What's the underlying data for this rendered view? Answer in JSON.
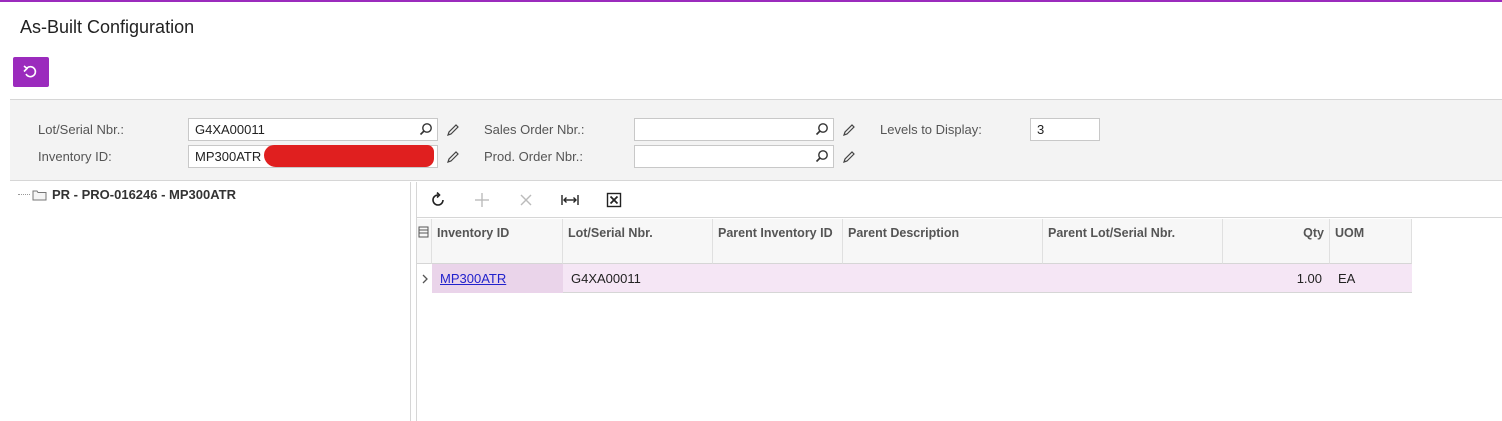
{
  "page": {
    "title": "As-Built Configuration"
  },
  "toolbar": {
    "undo_icon": "undo-icon"
  },
  "form": {
    "lot_serial_label": "Lot/Serial Nbr.:",
    "lot_serial_value": "G4XA00011",
    "inventory_id_label": "Inventory ID:",
    "inventory_id_value": "MP300ATR",
    "sales_order_label": "Sales Order Nbr.:",
    "sales_order_value": "",
    "prod_order_label": "Prod. Order Nbr.:",
    "prod_order_value": "",
    "levels_label": "Levels to Display:",
    "levels_value": "3"
  },
  "tree": {
    "nodes": [
      {
        "label": "PR - PRO-016246 - MP300ATR"
      }
    ]
  },
  "grid": {
    "toolbar_icons": [
      "refresh-icon",
      "add-icon",
      "delete-icon",
      "fit-columns-icon",
      "export-excel-icon"
    ],
    "columns": {
      "inventory_id": "Inventory ID",
      "lot_serial": "Lot/Serial Nbr.",
      "parent_inventory_id": "Parent Inventory ID",
      "parent_description": "Parent Description",
      "parent_lot_serial": "Parent Lot/Serial Nbr.",
      "qty": "Qty",
      "uom": "UOM"
    },
    "rows": [
      {
        "inventory_id": "MP300ATR",
        "lot_serial": "G4XA00011",
        "parent_inventory_id": "",
        "parent_description": "",
        "parent_lot_serial": "",
        "qty": "1.00",
        "uom": "EA"
      }
    ]
  },
  "colors": {
    "accent": "#9b2bbd",
    "row_selected": "#f5e6f5",
    "link": "#2222cc"
  }
}
